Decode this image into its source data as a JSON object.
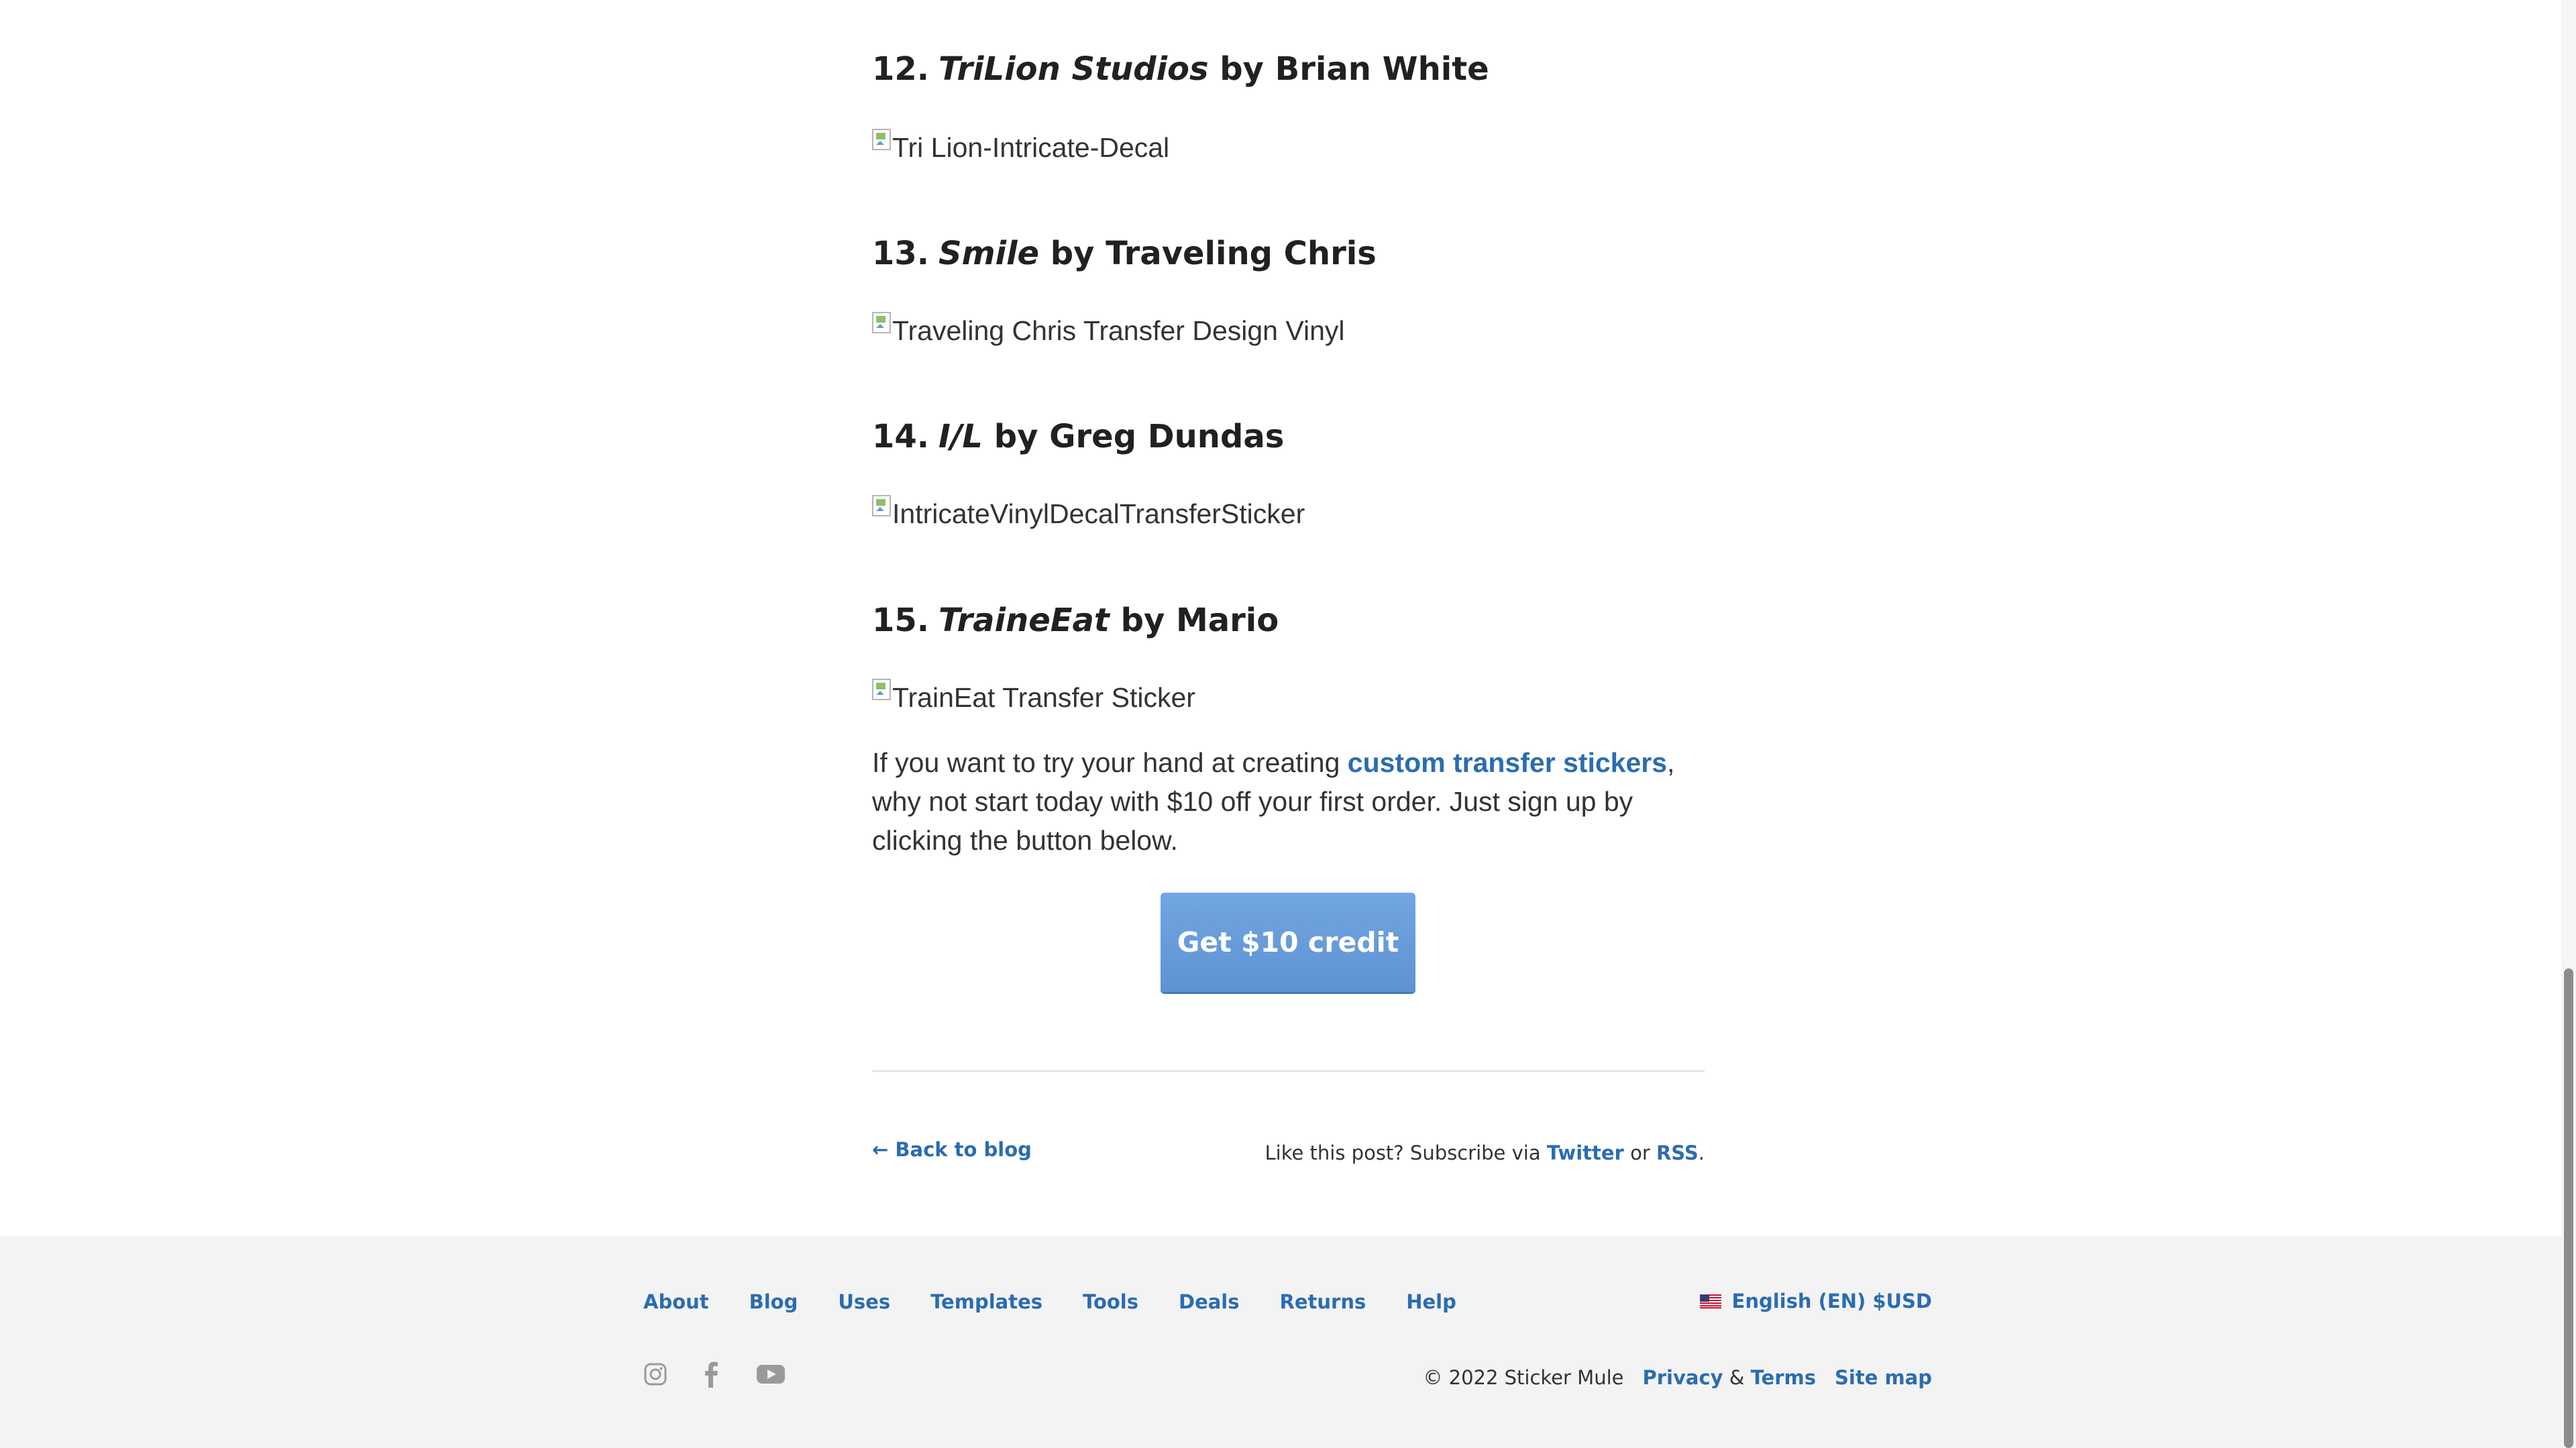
{
  "entries": [
    {
      "number": "12.",
      "title": "TriLion Studios",
      "byline": "by Brian White",
      "image_alt": "Tri Lion-Intricate-Decal"
    },
    {
      "number": "13.",
      "title": "Smile",
      "byline": "by Traveling Chris",
      "image_alt": "Traveling Chris Transfer Design Vinyl"
    },
    {
      "number": "14.",
      "title": "I/L",
      "byline": "by Greg Dundas",
      "image_alt": "IntricateVinylDecalTransferSticker"
    },
    {
      "number": "15.",
      "title": "TraineEat",
      "byline": "by Mario",
      "image_alt": "TrainEat Transfer Sticker"
    }
  ],
  "cta": {
    "text_before": "If you want to try your hand at creating ",
    "link_text": "custom transfer stickers",
    "text_after": ", why not start today with $10 off your first order. Just sign up by clicking the button below.",
    "button_label": "Get $10 credit"
  },
  "post_footer": {
    "back_label": "← Back to blog",
    "subscribe_prefix": "Like this post? Subscribe via ",
    "twitter_label": "Twitter",
    "or_text": " or ",
    "rss_label": "RSS",
    "end_punct": "."
  },
  "footer": {
    "nav": [
      "About",
      "Blog",
      "Uses",
      "Templates",
      "Tools",
      "Deals",
      "Returns",
      "Help"
    ],
    "locale_label": "English (EN) $USD",
    "social_icons": [
      "instagram-icon",
      "facebook-icon",
      "youtube-icon"
    ],
    "copyright": "© 2022 Sticker Mule",
    "privacy_label": "Privacy",
    "amp": " & ",
    "terms_label": "Terms",
    "sitemap_label": "Site map"
  },
  "colors": {
    "link": "#2b6cb0",
    "button": "#6b9fdd",
    "footer_bg": "#f3f3f3",
    "heading": "#212121"
  }
}
